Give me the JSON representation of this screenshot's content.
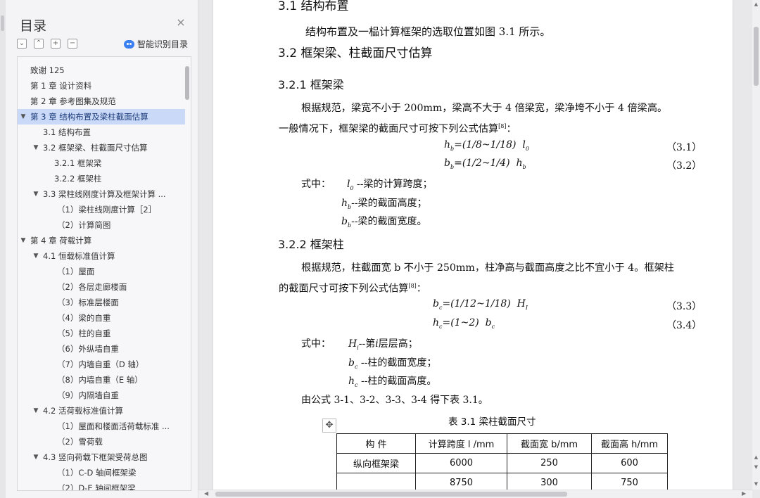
{
  "sidebar": {
    "title": "目录",
    "close_glyph": "×",
    "tools": [
      {
        "icon": "collapse-all-icon",
        "glyph": "⌄"
      },
      {
        "icon": "expand-all-icon",
        "glyph": "⌃"
      },
      {
        "icon": "add-icon",
        "glyph": "+"
      },
      {
        "icon": "remove-icon",
        "glyph": "−"
      }
    ],
    "smart_label": "智能识别目录",
    "toc": [
      {
        "label": "致谢 125",
        "level": 0,
        "chev": ""
      },
      {
        "label": "第 1 章  设计资料",
        "level": 0,
        "chev": ""
      },
      {
        "label": "第 2 章  参考图集及规范",
        "level": 0,
        "chev": ""
      },
      {
        "label": "第 3 章    结构布置及梁柱截面估算",
        "level": 0,
        "chev": "v",
        "selected": true
      },
      {
        "label": "3.1 结构布置",
        "level": 1,
        "chev": ""
      },
      {
        "label": "3.2 框架梁、柱截面尺寸估算",
        "level": 1,
        "chev": "v"
      },
      {
        "label": "3.2.1 框架梁",
        "level": 2,
        "chev": ""
      },
      {
        "label": "3.2.2 框架柱",
        "level": 2,
        "chev": ""
      },
      {
        "label": "3.3 梁柱线刚度计算及框架计算 ...",
        "level": 1,
        "chev": "v"
      },
      {
        "label": "（1）梁柱线刚度计算［2］",
        "level": 3,
        "chev": ""
      },
      {
        "label": "（2）计算简图",
        "level": 3,
        "chev": ""
      },
      {
        "label": "第 4 章  荷载计算",
        "level": 0,
        "chev": "v"
      },
      {
        "label": "4.1 恒载标准值计算",
        "level": 1,
        "chev": "v"
      },
      {
        "label": "（1）屋面",
        "level": 3,
        "chev": ""
      },
      {
        "label": "（2）各层走廊楼面",
        "level": 3,
        "chev": ""
      },
      {
        "label": "（3）标准层楼面",
        "level": 3,
        "chev": ""
      },
      {
        "label": "（4）梁的自重",
        "level": 3,
        "chev": ""
      },
      {
        "label": "（5）柱的自重",
        "level": 3,
        "chev": ""
      },
      {
        "label": "（6）外纵墙自重",
        "level": 3,
        "chev": ""
      },
      {
        "label": "（7）内墙自重（D 轴）",
        "level": 3,
        "chev": ""
      },
      {
        "label": "（8）内墙自重（E 轴）",
        "level": 3,
        "chev": ""
      },
      {
        "label": "（9）内隔墙自重",
        "level": 3,
        "chev": ""
      },
      {
        "label": "4.2 活荷载标准值计算",
        "level": 1,
        "chev": "v"
      },
      {
        "label": "（1）屋面和楼面活荷载标准 ...",
        "level": 3,
        "chev": ""
      },
      {
        "label": "（2）雪荷载",
        "level": 3,
        "chev": ""
      },
      {
        "label": "4.3 竖向荷载下框架受荷总图",
        "level": 1,
        "chev": "v"
      },
      {
        "label": "（1）C-D 轴间框架梁",
        "level": 3,
        "chev": ""
      },
      {
        "label": "（2）D-E 轴间框架梁",
        "level": 3,
        "chev": ""
      }
    ]
  },
  "document": {
    "cut_heading": "3.1 结构布置",
    "intro": "结构布置及一榀计算框架的选取位置如图 3.1 所示。",
    "h_32": "3.2 框架梁、柱截面尺寸估算",
    "h_321": "3.2.1 框架梁",
    "p1_a": "根据规范，梁宽不小于 200mm，梁高不大于 4 倍梁宽，梁净垮不小于 4 倍梁高。",
    "p1_b": "一般情况下，框架梁的截面尺寸可按下列公式估算",
    "p1_ref": "[8]",
    "p1_end": "：",
    "eq1": "h_b=(1/8~1/18) l_0",
    "eq1_no": "（3.1）",
    "eq2": "b_b=(1/2~1/4) h_b",
    "eq2_no": "（3.2）",
    "where1": "式中：",
    "w1_l0": "--梁的计算跨度；",
    "w1_hb": "--梁的截面高度；",
    "w1_bb": "--梁的截面宽度。",
    "h_322": "3.2.2 框架柱",
    "p2_a": "根据规范，柱截面宽 b 不小于 250mm，柱净高与截面高度之比不宜小于 4。框架柱",
    "p2_b": "的截面尺寸可按下列公式估算",
    "p2_ref": "[8]",
    "p2_end": "：",
    "eq3": "b_c=(1/12~1/18) H_I",
    "eq3_no": "（3.3）",
    "eq4": "h_c=(1~2) b_c",
    "eq4_no": "（3.4）",
    "where2": "式中：",
    "w2_hi_a": "--第",
    "w2_hi_b": "层层高；",
    "w2_bc": "--柱的截面宽度；",
    "w2_hc": "--柱的截面高度。",
    "summary": "由公式 3-1、3-2、3-3、3-4 得下表 3.1。",
    "table_caption": "表 3.1  梁柱截面尺寸",
    "table": {
      "headers": [
        "构   件",
        "计算跨度 l  /mm",
        "截面宽 b/mm",
        "截面高 h/mm"
      ],
      "rows": [
        [
          "纵向框架梁",
          "6000",
          "250",
          "600"
        ],
        [
          "",
          "8750",
          "300",
          "750"
        ]
      ]
    }
  }
}
